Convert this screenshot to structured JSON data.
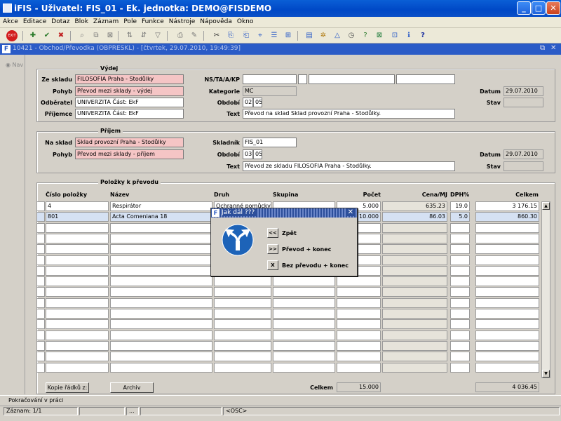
{
  "window": {
    "title": "iFIS - Uživatel: FIS_01 - Ek. jednotka: DEMO@FISDEMO"
  },
  "menu": [
    "Akce",
    "Editace",
    "Dotaz",
    "Blok",
    "Záznam",
    "Pole",
    "Funkce",
    "Nástroje",
    "Nápověda",
    "Okno"
  ],
  "inner_window": {
    "title": "10421 - Obchod/Převodka (OBPRESKL) - [čtvrtek, 29.07.2010, 19:49:39]"
  },
  "nav_label": "Nav",
  "vydej": {
    "title": "Výdej",
    "ze_skladu_label": "Ze skladu",
    "ze_skladu": "FILOSOFIA Praha - Stodůlky",
    "pohyb_label": "Pohyb",
    "pohyb": "Převod mezi sklady - výdej",
    "odberatel_label": "Odběratel",
    "odberatel": "UNIVERZITA Část: EkF",
    "prijemce_label": "Příjemce",
    "prijemce": "UNIVERZITA Část: EkF",
    "ns_label": "NS/TA/A/KP",
    "kategorie_label": "Kategorie",
    "kategorie": "MC",
    "obdobi_label": "Období",
    "obdobi_a": "02",
    "obdobi_b": "05",
    "text_label": "Text",
    "text": "Převod na sklad Sklad provozní Praha - Stodůlky.",
    "datum_label": "Datum",
    "datum": "29.07.2010",
    "stav_label": "Stav"
  },
  "prijem": {
    "title": "Příjem",
    "na_sklad_label": "Na sklad",
    "na_sklad": "Sklad provozní Praha - Stodůlky",
    "pohyb_label": "Pohyb",
    "pohyb": "Převod mezi sklady - příjem",
    "skladnik_label": "Skladník",
    "skladnik": "FIS_01",
    "obdobi_label": "Období",
    "obdobi_a": "03",
    "obdobi_b": "05",
    "text_label": "Text",
    "text": "Převod ze skladu FILOSOFIA Praha - Stodůlky.",
    "datum_label": "Datum",
    "datum": "29.07.2010",
    "stav_label": "Stav"
  },
  "polozky": {
    "title": "Položky k převodu",
    "headers": {
      "cislo": "Číslo položky",
      "nazev": "Název",
      "druh": "Druh",
      "skupina": "Skupina",
      "pocet": "Počet",
      "cena": "Cena/MJ",
      "dph": "DPH%",
      "celkem": "Celkem"
    },
    "rows": [
      {
        "cislo": "4",
        "nazev": "Respirátor",
        "druh": "Ochranné pomůcky",
        "skupina": "",
        "pocet": "5.000",
        "cena": "635.23",
        "dph": "19.0",
        "celkem": "3 176.15"
      },
      {
        "cislo": "801",
        "nazev": "Acta Comeniana 18",
        "druh": "",
        "skupina": "",
        "pocet": "10.000",
        "cena": "86.03",
        "dph": "5.0",
        "celkem": "860.30"
      }
    ],
    "kopie_button": "Kopie řádků z:",
    "archiv_button": "Archiv",
    "celkem_label": "Celkem",
    "celkem_pocet": "15.000",
    "celkem_sum": "4 036.45"
  },
  "dialog": {
    "title": "Jak dál ???",
    "options": [
      {
        "btn": "<<",
        "label": "Zpět"
      },
      {
        "btn": ">>",
        "label": "Převod + konec"
      },
      {
        "btn": "X",
        "label": "Bez převodu + konec"
      }
    ]
  },
  "status": {
    "message": "Pokračování v práci",
    "record": "Záznam: 1/1",
    "dots": "...",
    "osc": "<OSC>"
  },
  "colors": {
    "title_blue": "#0048c6",
    "required_pink": "#f5c5c5",
    "selected_row": "#d5e1f3"
  }
}
